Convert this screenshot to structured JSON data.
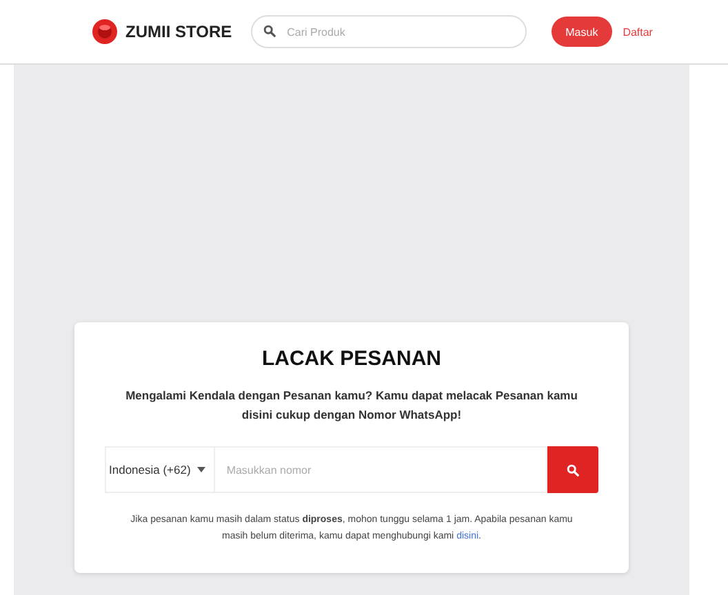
{
  "header": {
    "brand": "ZUMII STORE",
    "search": {
      "placeholder": "Cari Produk"
    },
    "login_button": "Masuk",
    "register_link": "Daftar"
  },
  "tracker": {
    "title": "LACAK PESANAN",
    "intro": "Mengalami Kendala dengan Pesanan kamu? Kamu dapat melacak Pesanan kamu disini cukup dengan Nomor WhatsApp!",
    "country_select": "Indonesia (+62)",
    "phone": {
      "placeholder": "Masukkan nomor"
    },
    "note": "Jika pesanan kamu masih dalam status **diproses**, mohon tunggu selama 1 jam. Apabila pesanan kamu masih belum diterima, kamu dapat menghubungi kami ",
    "note_link": "disini",
    "note_end": "."
  }
}
